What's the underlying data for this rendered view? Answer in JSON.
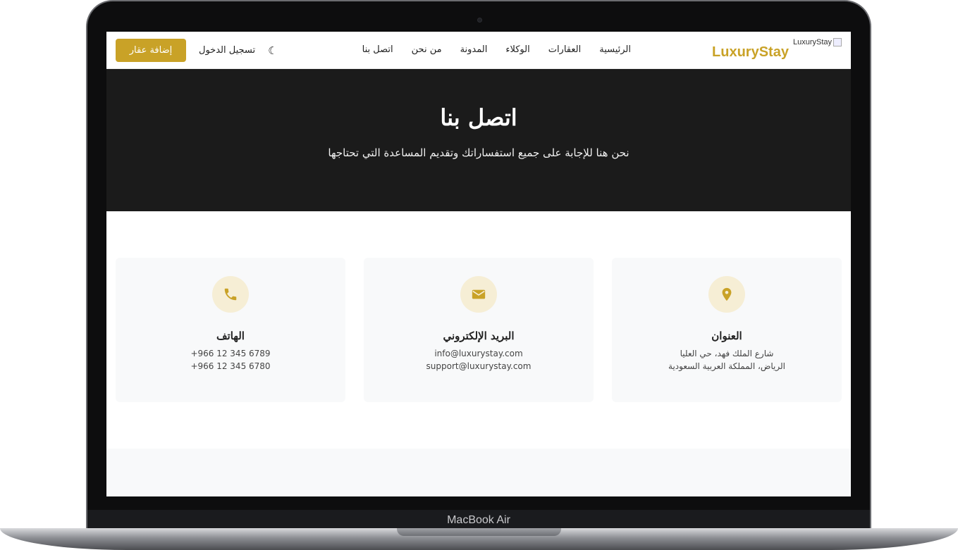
{
  "nav": {
    "brand": "LuxuryStay",
    "logo_alt": "LuxuryStay",
    "items": [
      {
        "label": "الرئيسية"
      },
      {
        "label": "العقارات"
      },
      {
        "label": "الوكلاء"
      },
      {
        "label": "المدونة"
      },
      {
        "label": "من نحن"
      },
      {
        "label": "اتصل بنا"
      }
    ],
    "login": "تسجيل الدخول",
    "add_property": "إضافة عقار"
  },
  "hero": {
    "title": "اتصل بنا",
    "subtitle": "نحن هنا للإجابة على جميع استفساراتك وتقديم المساعدة التي تحتاجها"
  },
  "cards": [
    {
      "title": "العنوان",
      "lines": [
        "شارع الملك فهد، حي العليا",
        "الرياض، المملكة العربية السعودية"
      ],
      "icon": "map-pin-icon"
    },
    {
      "title": "البريد الإلكتروني",
      "lines": [
        "info@luxurystay.com",
        "support@luxurystay.com"
      ],
      "icon": "envelope-icon"
    },
    {
      "title": "الهاتف",
      "lines": [
        "+966 12 345 6789",
        "+966 12 345 6780"
      ],
      "icon": "phone-icon"
    }
  ],
  "device": {
    "label": "MacBook Air"
  },
  "colors": {
    "accent": "#c9a227",
    "hero_bg": "#1b1b1b",
    "card_bg": "#f8f9fa",
    "icon_bg": "#f6eed5"
  }
}
